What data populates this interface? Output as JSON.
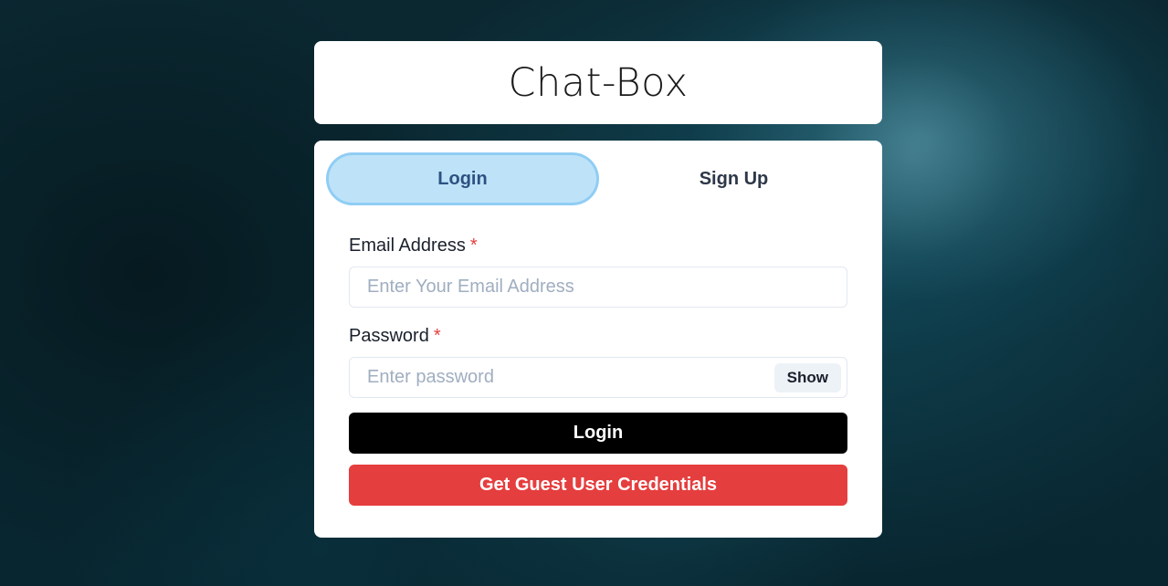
{
  "app": {
    "title": "Chat-Box"
  },
  "tabs": [
    {
      "label": "Login",
      "active": true
    },
    {
      "label": "Sign Up",
      "active": false
    }
  ],
  "form": {
    "email": {
      "label": "Email Address",
      "required_marker": "*",
      "placeholder": "Enter Your Email Address",
      "value": ""
    },
    "password": {
      "label": "Password",
      "required_marker": "*",
      "placeholder": "Enter password",
      "value": "",
      "toggle_label": "Show"
    },
    "submit_label": "Login",
    "guest_label": "Get Guest User Credentials"
  },
  "colors": {
    "active_tab_bg": "#bee3f8",
    "active_tab_ring": "#90cdf4",
    "login_button": "#000000",
    "guest_button": "#e53e3e",
    "required_marker": "#e53e3e"
  }
}
